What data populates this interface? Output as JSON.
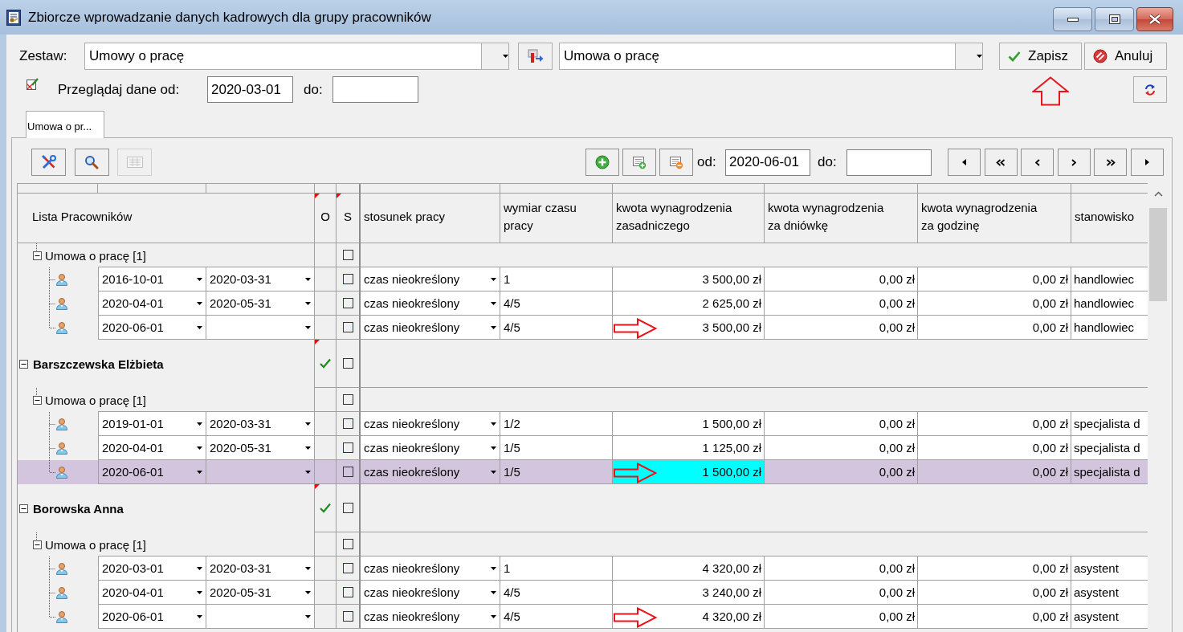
{
  "window": {
    "title": "Zbiorcze wprowadzanie danych kadrowych dla grupy pracowników"
  },
  "set": {
    "label": "Zestaw:",
    "value": "Umowy o pracę"
  },
  "template": {
    "value": "Umowa o pracę"
  },
  "actions": [
    {
      "label": "Zapisz",
      "kind": "save",
      "annotated": true
    },
    {
      "label": "Anuluj",
      "kind": "cancel",
      "annotated": false
    }
  ],
  "range": {
    "label": "Przeglądaj dane od:",
    "from": "2020-03-01",
    "to_label": "do:"
  },
  "tabs": [
    {
      "label": "Umowa o pr...",
      "selected": true
    }
  ],
  "grid_toolbar": {
    "tools": [
      {
        "kind": "tools",
        "disabled": false
      },
      {
        "kind": "search",
        "disabled": false
      },
      {
        "kind": "keypad",
        "disabled": true
      }
    ],
    "from_label": "od:",
    "from": "2020-06-01",
    "to_label": "do:"
  },
  "table": {
    "columns": [
      {
        "label": "Lista Pracowników",
        "note": false
      },
      {
        "label": "O",
        "note": true
      },
      {
        "label": "S",
        "note": true
      },
      {
        "label": "stosunek pracy",
        "note": false
      },
      {
        "label": "wymiar czasu\npracy",
        "note": false
      },
      {
        "label": "kwota wynagrodzenia\nzasadniczego",
        "note": false
      },
      {
        "label": "kwota wynagrodzenia\nza dniówkę",
        "note": false
      },
      {
        "label": "kwota wynagrodzenia\nza godzinę",
        "note": false
      },
      {
        "label": "stanowisko",
        "note": false
      }
    ],
    "tree": [
      {
        "kind": "contract",
        "label": "Umowa o pracę [1]",
        "expanded": true,
        "checked": false,
        "children": [
          {
            "kind": "record",
            "from": "2016-10-01",
            "to": "2020-03-31",
            "checked": false,
            "employment": "czas nieokreślony",
            "working_time": "1",
            "base_salary": "3 500,00 zł",
            "daily_rate": "0,00 zł",
            "hourly_rate": "0,00 zł",
            "position": "handlowiec",
            "selected": false,
            "focused": false,
            "annotated": false
          },
          {
            "kind": "record",
            "from": "2020-04-01",
            "to": "2020-05-31",
            "checked": false,
            "employment": "czas nieokreślony",
            "working_time": "4/5",
            "base_salary": "2 625,00 zł",
            "daily_rate": "0,00 zł",
            "hourly_rate": "0,00 zł",
            "position": "handlowiec",
            "selected": false,
            "focused": false,
            "annotated": false
          },
          {
            "kind": "record",
            "from": "2020-06-01",
            "checked": false,
            "employment": "czas nieokreślony",
            "working_time": "4/5",
            "base_salary": "3 500,00 zł",
            "daily_rate": "0,00 zł",
            "hourly_rate": "0,00 zł",
            "position": "handlowiec",
            "selected": false,
            "focused": false,
            "annotated": true
          }
        ]
      },
      {
        "kind": "employee",
        "label": "Barszczewska Elżbieta",
        "expanded": true,
        "approved": true,
        "note": true,
        "checked": false,
        "children": [
          {
            "kind": "contract",
            "label": "Umowa o pracę [1]",
            "expanded": true,
            "checked": false,
            "children": [
              {
                "kind": "record",
                "from": "2019-01-01",
                "to": "2020-03-31",
                "checked": false,
                "employment": "czas nieokreślony",
                "working_time": "1/2",
                "base_salary": "1 500,00 zł",
                "daily_rate": "0,00 zł",
                "hourly_rate": "0,00 zł",
                "position": "specjalista d",
                "selected": false,
                "focused": false,
                "annotated": false
              },
              {
                "kind": "record",
                "from": "2020-04-01",
                "to": "2020-05-31",
                "checked": false,
                "employment": "czas nieokreślony",
                "working_time": "1/5",
                "base_salary": "1 125,00 zł",
                "daily_rate": "0,00 zł",
                "hourly_rate": "0,00 zł",
                "position": "specjalista d",
                "selected": false,
                "focused": false,
                "annotated": false
              },
              {
                "kind": "record",
                "from": "2020-06-01",
                "checked": false,
                "employment": "czas nieokreślony",
                "working_time": "1/5",
                "base_salary": "1 500,00 zł",
                "daily_rate": "0,00 zł",
                "hourly_rate": "0,00 zł",
                "position": "specjalista d",
                "selected": true,
                "focused": true,
                "annotated": true
              }
            ]
          }
        ]
      },
      {
        "kind": "employee",
        "label": "Borowska Anna",
        "expanded": true,
        "approved": true,
        "note": true,
        "checked": false,
        "children": [
          {
            "kind": "contract",
            "label": "Umowa o pracę [1]",
            "expanded": true,
            "checked": false,
            "children": [
              {
                "kind": "record",
                "from": "2020-03-01",
                "to": "2020-03-31",
                "checked": false,
                "employment": "czas nieokreślony",
                "working_time": "1",
                "base_salary": "4 320,00 zł",
                "daily_rate": "0,00 zł",
                "hourly_rate": "0,00 zł",
                "position": "asystent",
                "selected": false,
                "focused": false,
                "annotated": false
              },
              {
                "kind": "record",
                "from": "2020-04-01",
                "to": "2020-05-31",
                "checked": false,
                "employment": "czas nieokreślony",
                "working_time": "4/5",
                "base_salary": "3 240,00 zł",
                "daily_rate": "0,00 zł",
                "hourly_rate": "0,00 zł",
                "position": "asystent",
                "selected": false,
                "focused": false,
                "annotated": false
              },
              {
                "kind": "record",
                "from": "2020-06-01",
                "checked": false,
                "employment": "czas nieokreślony",
                "working_time": "4/5",
                "base_salary": "4 320,00 zł",
                "daily_rate": "0,00 zł",
                "hourly_rate": "0,00 zł",
                "position": "asystent",
                "selected": false,
                "focused": false,
                "annotated": true
              }
            ]
          }
        ]
      }
    ]
  }
}
